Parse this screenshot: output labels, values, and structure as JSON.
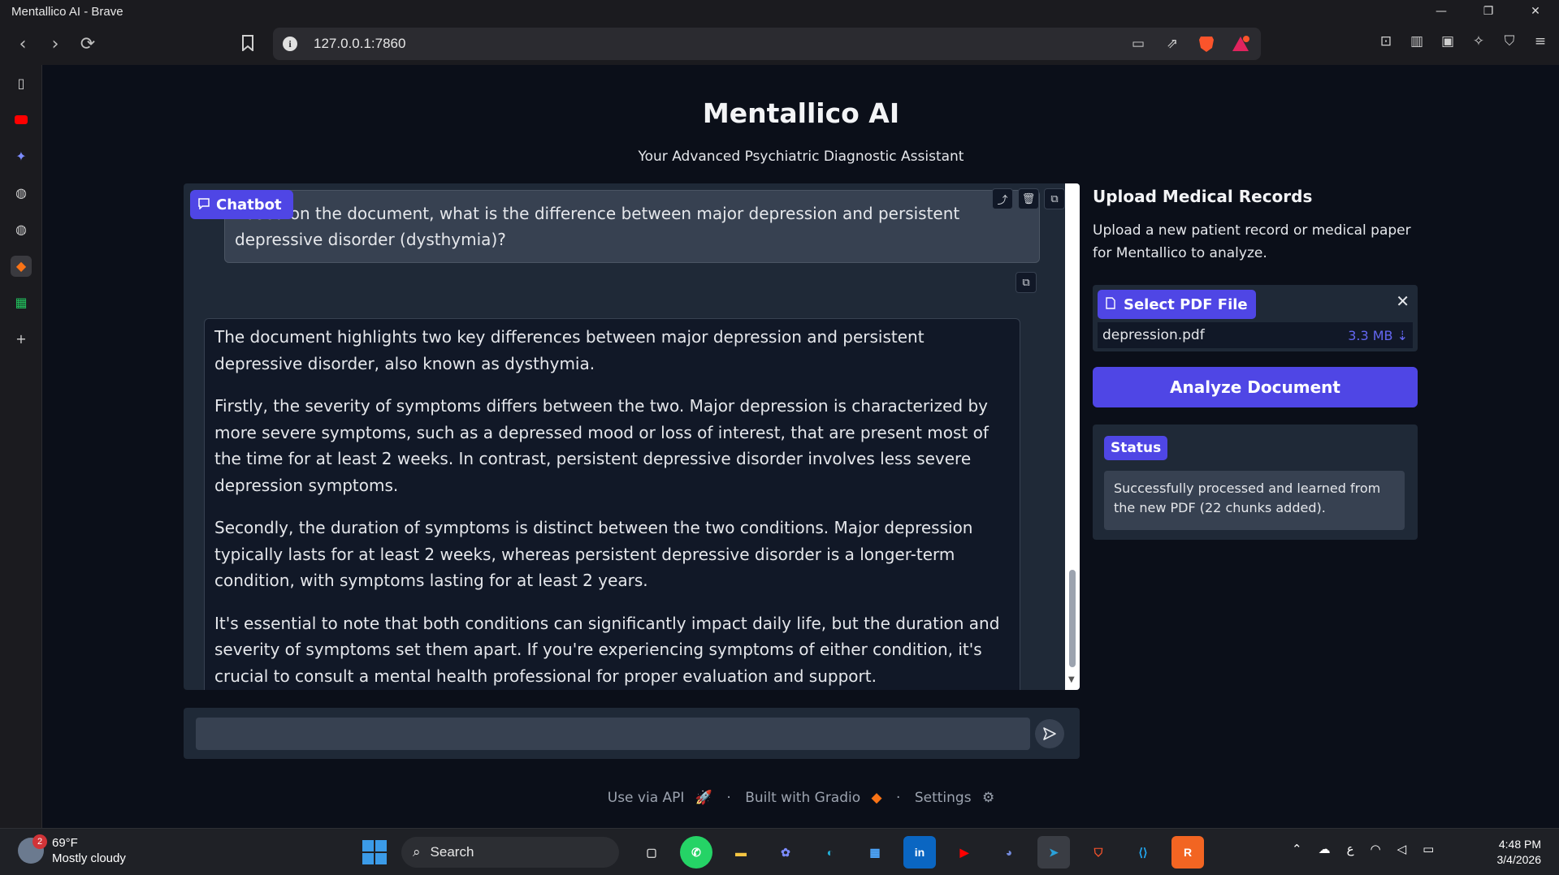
{
  "window": {
    "title": "Mentallico AI - Brave"
  },
  "browser": {
    "url": "127.0.0.1:7860"
  },
  "app": {
    "title": "Mentallico AI",
    "subtitle": "Your Advanced Psychiatric Diagnostic Assistant"
  },
  "chatbot": {
    "label": "Chatbot",
    "user_message": "Based on the document, what is the difference between major depression and persistent depressive disorder (dysthymia)?",
    "bot_paragraphs": [
      "The document highlights two key differences between major depression and persistent depressive disorder, also known as dysthymia.",
      "Firstly, the severity of symptoms differs between the two. Major depression is characterized by more severe symptoms, such as a depressed mood or loss of interest, that are present most of the time for at least 2 weeks. In contrast, persistent depressive disorder involves less severe depression symptoms.",
      "Secondly, the duration of symptoms is distinct between the two conditions. Major depression typically lasts for at least 2 weeks, whereas persistent depressive disorder is a longer-term condition, with symptoms lasting for at least 2 years.",
      "It's essential to note that both conditions can significantly impact daily life, but the duration and severity of symptoms set them apart. If you're experiencing symptoms of either condition, it's crucial to consult a mental health professional for proper evaluation and support."
    ],
    "input_value": ""
  },
  "upload": {
    "heading": "Upload Medical Records",
    "description": "Upload a new patient record or medical paper for Mentallico to analyze.",
    "select_label": "Select PDF File",
    "file_name": "depression.pdf",
    "file_size": "3.3 MB ⇣",
    "analyze_label": "Analyze Document"
  },
  "status": {
    "label": "Status",
    "text": "Successfully processed and learned from the new PDF (22 chunks added)."
  },
  "footer": {
    "api": "Use via API",
    "gradio": "Built with Gradio",
    "settings": "Settings",
    "sep": "·"
  },
  "taskbar": {
    "weather_badge": "2",
    "temperature": "69°F",
    "weather": "Mostly cloudy",
    "search": "Search",
    "time": "4:48 PM",
    "date": "3/4/2026",
    "lang": "ع"
  },
  "colors": {
    "accent": "#4f46e5",
    "panel": "#1f2937",
    "background": "#0b0f19"
  }
}
